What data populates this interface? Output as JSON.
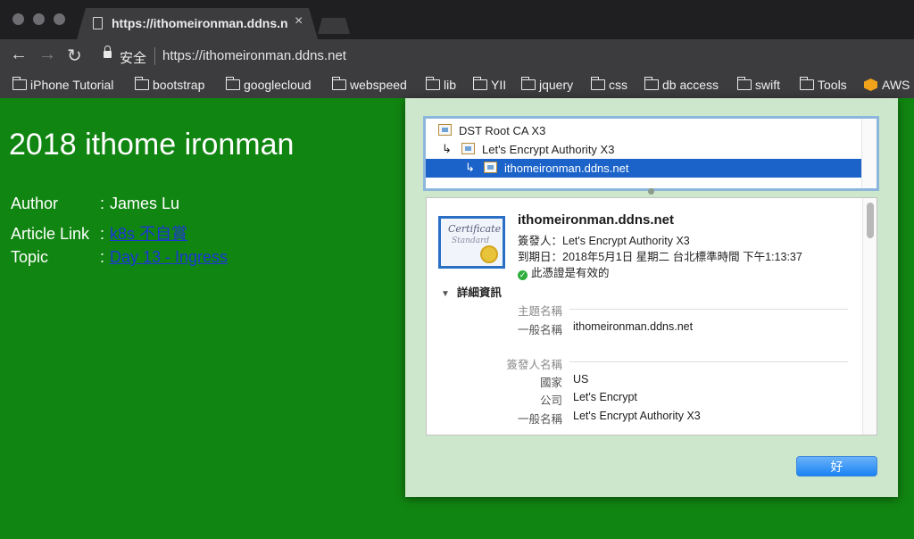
{
  "browser": {
    "tab_title": "https://ithomeironman.ddns.net",
    "close_glyph": "×",
    "secure_label": "安全",
    "url": "https://ithomeironman.ddns.net",
    "bookmarks": [
      "iPhone Tutorial",
      "bootstrap",
      "googlecloud",
      "webspeed",
      "lib",
      "YII",
      "jquery",
      "css",
      "db access",
      "swift",
      "Tools",
      "AWS"
    ]
  },
  "page": {
    "title": "2018 ithome ironman",
    "rows": [
      {
        "key": "Author",
        "value": "James Lu"
      },
      {
        "key": "Article Link",
        "value": "k8s 不自賞"
      },
      {
        "key": "Topic",
        "value": "Day 13 - Ingress"
      }
    ]
  },
  "dialog": {
    "chain": [
      "DST Root CA X3",
      "Let's Encrypt Authority X3",
      "ithomeironman.ddns.net"
    ],
    "icon_text_1": "Certificate",
    "icon_text_2": "Standard",
    "cert_name": "ithomeironman.ddns.net",
    "issuer_line": "簽發人：Let's Encrypt Authority X3",
    "expiry_line": "到期日：2018年5月1日 星期二 台北標準時間 下午1:13:37",
    "valid_text": "此憑證是有效的",
    "details_label": "詳細資訊",
    "subject_heading": "主題名稱",
    "subject": [
      {
        "key": "一般名稱",
        "value": "ithomeironman.ddns.net"
      }
    ],
    "issuer_heading": "簽發人名稱",
    "issuer": [
      {
        "key": "國家",
        "value": "US"
      },
      {
        "key": "公司",
        "value": "Let's Encrypt"
      },
      {
        "key": "一般名稱",
        "value": "Let's Encrypt Authority X3"
      }
    ],
    "ok_label": "好"
  },
  "colors": {
    "page_background": "#118511",
    "link": "#1b37d6",
    "dialog_background": "#cde7cd",
    "selection": "#1b63c9"
  }
}
